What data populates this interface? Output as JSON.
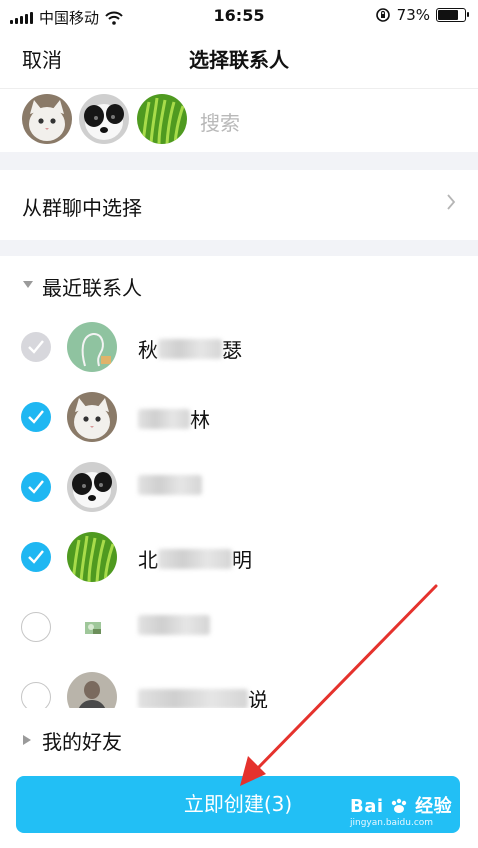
{
  "status_bar": {
    "carrier": "中国移动",
    "time": "16:55",
    "battery_percent": "73%",
    "battery_level": 0.73,
    "icons": [
      "signal-icon",
      "wifi-icon",
      "rotation-lock-icon",
      "battery-icon"
    ]
  },
  "nav": {
    "cancel_label": "取消",
    "title": "选择联系人"
  },
  "selected": {
    "avatars": [
      "cat-avatar",
      "dog-avatar",
      "grass-avatar"
    ],
    "search_placeholder": "搜索"
  },
  "group_select": {
    "label": "从群聊中选择",
    "icon": "chevron-right-icon"
  },
  "recent_section": {
    "label": "最近联系人",
    "icon": "triangle-down-icon",
    "contacts": [
      {
        "state": "disabled",
        "avatar": "outline-avatar",
        "name_visible": [
          "秋",
          "瑟"
        ]
      },
      {
        "state": "checked",
        "avatar": "cat-avatar",
        "name_visible": [
          "",
          "林"
        ]
      },
      {
        "state": "checked",
        "avatar": "dog-avatar",
        "name_visible": [
          "",
          ""
        ]
      },
      {
        "state": "checked",
        "avatar": "grass-avatar",
        "name_visible": [
          "北",
          "明"
        ]
      },
      {
        "state": "unchecked",
        "avatar": "small-photo-avatar",
        "name_visible": [
          "",
          ""
        ]
      },
      {
        "state": "unchecked",
        "avatar": "person-avatar",
        "name_visible": [
          "",
          "说"
        ]
      }
    ]
  },
  "friends_section": {
    "label": "我的好友",
    "icon": "triangle-right-icon"
  },
  "create_button": {
    "label": "立即创建(3)"
  },
  "watermark": {
    "brand": "Bai",
    "suffix": "经验",
    "url": "jingyan.baidu.com"
  },
  "colors": {
    "accent": "#1fb7f2",
    "button": "#22bff5",
    "arrow": "#e5322d",
    "divider_gap": "#f2f3f7"
  }
}
